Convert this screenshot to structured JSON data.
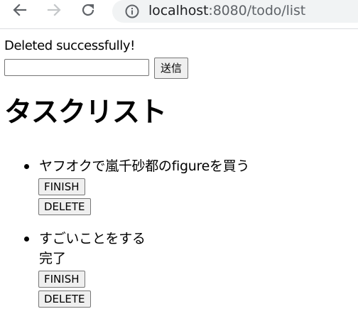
{
  "browser": {
    "url_host": "localhost",
    "url_rest": ":8080/todo/list",
    "icons": [
      "back-arrow-icon",
      "forward-arrow-icon",
      "reload-icon",
      "info-icon"
    ]
  },
  "page": {
    "flash_message": "Deleted successfully!",
    "task_input_value": "",
    "send_label": "送信",
    "heading": "タスクリスト",
    "tasks": [
      {
        "title": "ヤフオクで嵐千砂都のfigureを買う",
        "status": "",
        "finish_label": "FINISH",
        "delete_label": "DELETE"
      },
      {
        "title": "すごいことをする",
        "status": "完了",
        "finish_label": "FINISH",
        "delete_label": "DELETE"
      }
    ]
  },
  "colors": {
    "omnibox_bg": "#f1f3f4",
    "icon_active": "#5f6368",
    "icon_disabled": "#c4c7c9",
    "button_bg": "#efefef"
  }
}
